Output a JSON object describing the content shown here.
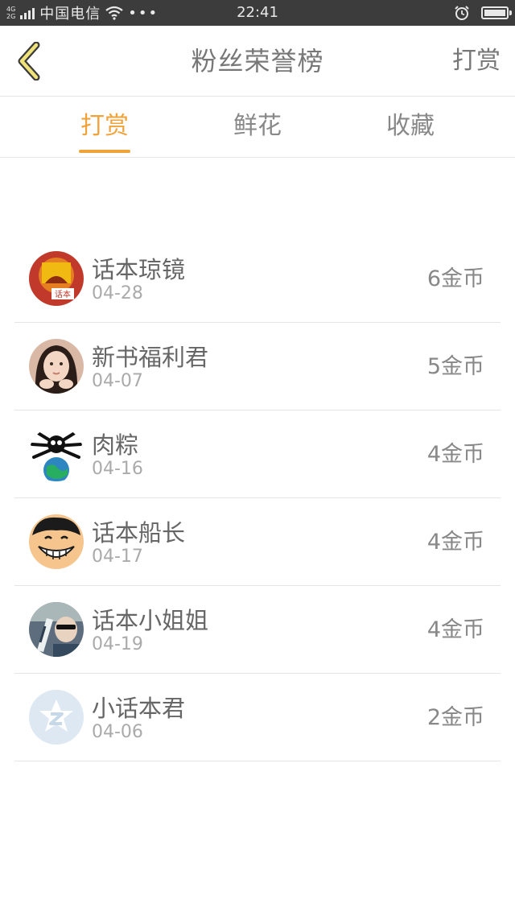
{
  "status_bar": {
    "net_top": "4G",
    "net_bottom": "2G",
    "carrier": "中国电信",
    "dots": "•••",
    "time": "22:41"
  },
  "nav": {
    "back_icon": "chevron-left-icon",
    "title": "粉丝荣誉榜",
    "action_label": "打赏"
  },
  "tabs": [
    {
      "label": "打赏",
      "active": true
    },
    {
      "label": "鲜花",
      "active": false
    },
    {
      "label": "收藏",
      "active": false
    }
  ],
  "accent_color": "#f0a33a",
  "list": [
    {
      "name": "话本琼镜",
      "date": "04-28",
      "amount": "6金币",
      "avatar": "orange-logo-avatar"
    },
    {
      "name": "新书福利君",
      "date": "04-07",
      "amount": "5金币",
      "avatar": "girl-photo-avatar"
    },
    {
      "name": "肉粽",
      "date": "04-16",
      "amount": "4金币",
      "avatar": "spider-earth-avatar"
    },
    {
      "name": "话本船长",
      "date": "04-17",
      "amount": "4金币",
      "avatar": "cartoon-face-avatar"
    },
    {
      "name": "话本小姐姐",
      "date": "04-19",
      "amount": "4金币",
      "avatar": "car-selfie-avatar"
    },
    {
      "name": "小话本君",
      "date": "04-06",
      "amount": "2金币",
      "avatar": "default-z-avatar"
    }
  ]
}
